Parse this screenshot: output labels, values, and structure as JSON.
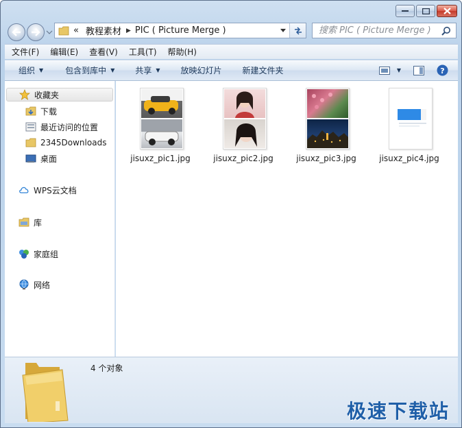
{
  "address": {
    "overflow": "«",
    "crumbs": [
      "教程素材",
      "PIC ( Picture Merge )"
    ]
  },
  "search": {
    "placeholder": "搜索 PIC ( Picture Merge )"
  },
  "menu": [
    "文件(F)",
    "编辑(E)",
    "查看(V)",
    "工具(T)",
    "帮助(H)"
  ],
  "toolbar": {
    "organize": "组织",
    "include_library": "包含到库中",
    "share": "共享",
    "slideshow": "放映幻灯片",
    "new_folder": "新建文件夹"
  },
  "sidebar": {
    "favorites": "收藏夹",
    "downloads": "下载",
    "recent": "最近访问的位置",
    "downloads2345": "2345Downloads",
    "desktop": "桌面",
    "wps": "WPS云文档",
    "libraries": "库",
    "homegroup": "家庭组",
    "network": "网络"
  },
  "files": [
    {
      "name": "jisuxz_pic1.jpg"
    },
    {
      "name": "jisuxz_pic2.jpg"
    },
    {
      "name": "jisuxz_pic3.jpg"
    },
    {
      "name": "jisuxz_pic4.jpg"
    }
  ],
  "status": {
    "count": "4 个对象"
  },
  "watermark": "极速下载站",
  "colors": {
    "accent": "#1f5fa8",
    "selection": "#e6e6e6"
  }
}
